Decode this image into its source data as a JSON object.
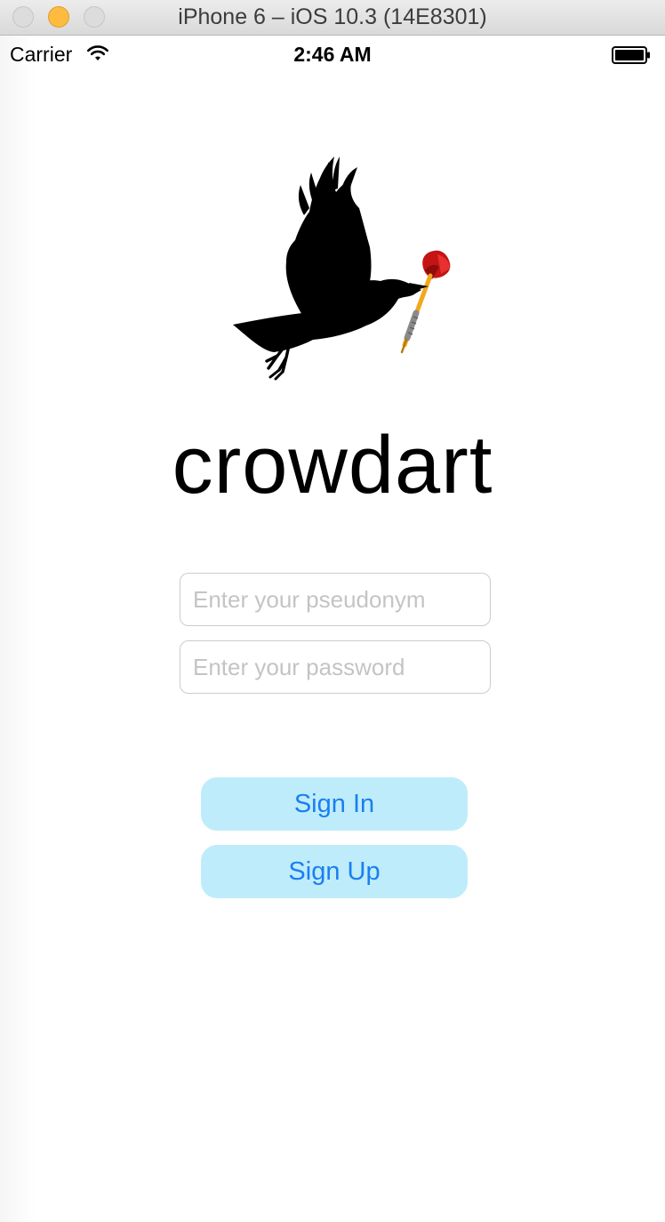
{
  "window": {
    "title": "iPhone 6 – iOS 10.3 (14E8301)"
  },
  "status_bar": {
    "carrier": "Carrier",
    "time": "2:46 AM",
    "wifi_icon": "wifi-icon",
    "battery_icon": "battery-icon"
  },
  "logo": {
    "icon": "crow-with-dart-logo"
  },
  "app": {
    "title": "crowdart"
  },
  "form": {
    "pseudonym_placeholder": "Enter your pseudonym",
    "pseudonym_value": "",
    "password_placeholder": "Enter your password",
    "password_value": ""
  },
  "buttons": {
    "sign_in": "Sign In",
    "sign_up": "Sign Up"
  },
  "colors": {
    "button_background": "#bfecfb",
    "button_text": "#1a7ff0",
    "minimize_light": "#fdbc40"
  }
}
